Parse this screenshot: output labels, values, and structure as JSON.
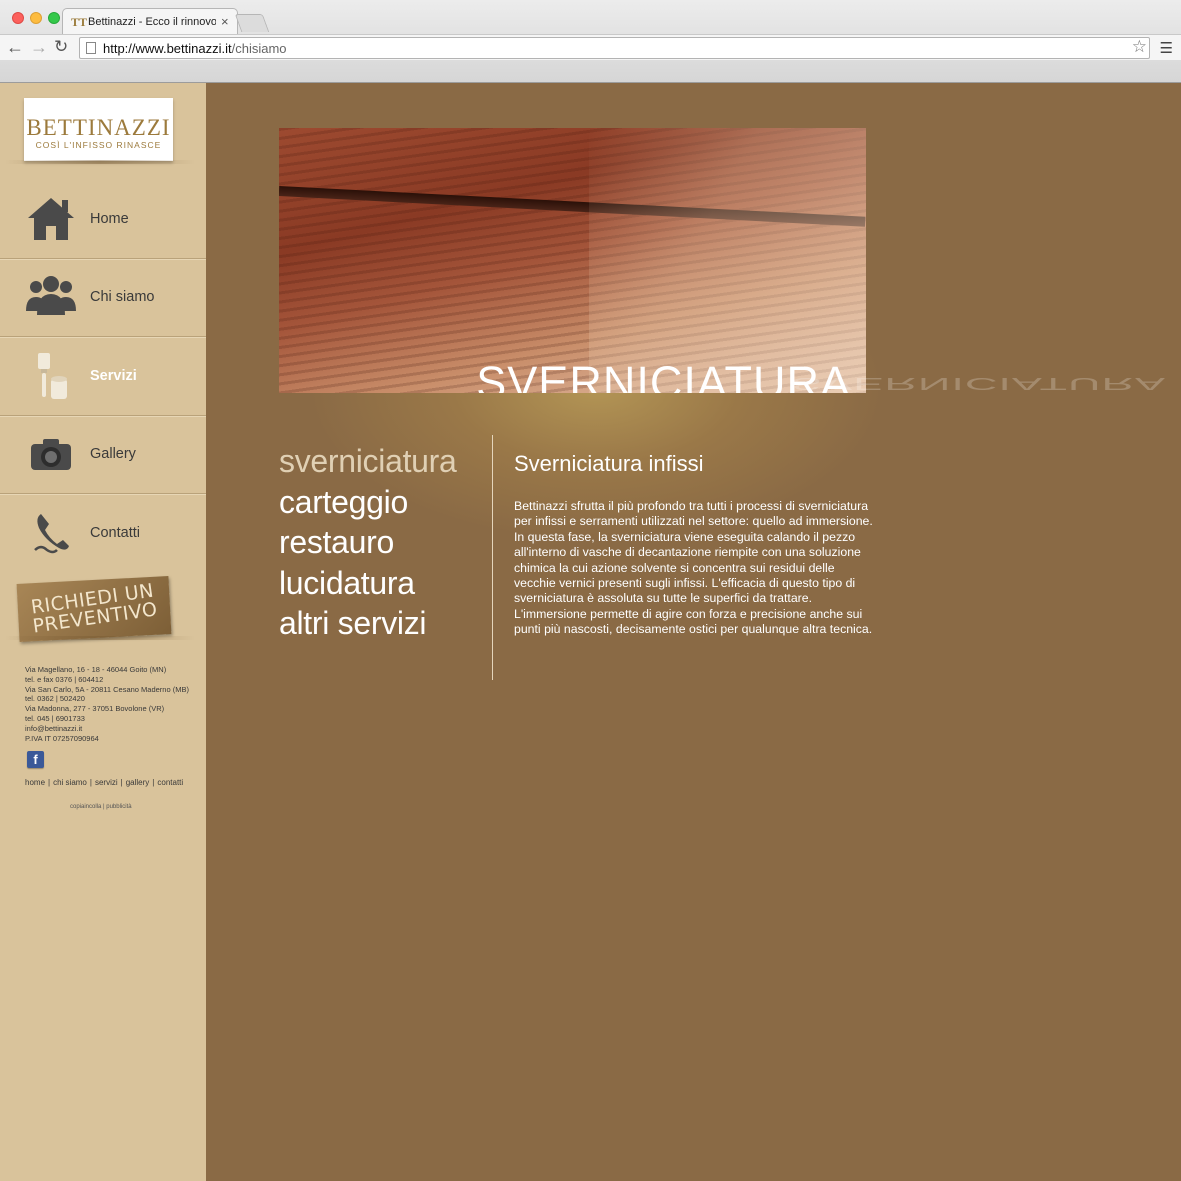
{
  "browser": {
    "tab_title": "Bettinazzi - Ecco il rinnovo",
    "tab_close": "×",
    "favicon": "TT",
    "url_host": "http://www.bettinazzi.it",
    "url_path": "/chisiamo",
    "icons": [
      "back-arrow-icon",
      "forward-arrow-icon",
      "reload-icon",
      "page-icon",
      "bookmark-star-icon",
      "menu-icon"
    ]
  },
  "brand": {
    "logo_text": "BETTINAZZI",
    "tagline": "COSÌ L'INFISSO RINASCE",
    "color": "#9c7a3c"
  },
  "nav": [
    {
      "label": "Home",
      "icon": "house-icon",
      "active": false
    },
    {
      "label": "Chi siamo",
      "icon": "people-icon",
      "active": false
    },
    {
      "label": "Servizi",
      "icon": "paintbrush-icon",
      "active": true
    },
    {
      "label": "Gallery",
      "icon": "camera-icon",
      "active": false
    },
    {
      "label": "Contatti",
      "icon": "phone-icon",
      "active": false
    }
  ],
  "cta": {
    "line1": "RICHIEDI UN",
    "line2": "PREVENTIVO"
  },
  "address": [
    "Via Magellano, 16 - 18 - 46044 Goito (MN)",
    "tel. e fax 0376 | 604412",
    "Via San Carlo, 5A - 20811 Cesano Maderno (MB)",
    "tel. 0362 | 502420",
    "Via Madonna, 277 - 37051 Bovolone (VR)",
    "tel. 045 | 6901733",
    "info@bettinazzi.it",
    "P.IVA IT 07257090964"
  ],
  "social": {
    "facebook": "f"
  },
  "footer_links": [
    "home",
    "chi siamo",
    "servizi",
    "gallery",
    "contatti"
  ],
  "credit": "copiaincolla | pubblicità",
  "hero": {
    "title": "SVERNICIATURA"
  },
  "services": [
    {
      "label": "sverniciatura",
      "current": true
    },
    {
      "label": "carteggio",
      "current": false
    },
    {
      "label": "restauro",
      "current": false
    },
    {
      "label": "lucidatura",
      "current": false
    },
    {
      "label": "altri servizi",
      "current": false
    }
  ],
  "content": {
    "title": "Sverniciatura infissi",
    "body": "Bettinazzi sfrutta il più profondo tra tutti i processi di sverniciatura per infissi e serramenti utilizzati nel settore: quello ad immersione. In questa fase, la sverniciatura viene eseguita calando il pezzo all'interno di vasche di decantazione riempite con una soluzione chimica la cui azione solvente si concentra sui residui delle vecchie vernici presenti sugli infissi. L'efficacia di questo tipo di sverniciatura è assoluta su tutte le superfici da trattare. L'immersione permette di agire con forza e precisione anche sui punti più nascosti, decisamente ostici per qualunque altra tecnica."
  },
  "colors": {
    "sidebar": "#d9c39b",
    "main": "#8a6a45",
    "accent": "#b39555"
  }
}
